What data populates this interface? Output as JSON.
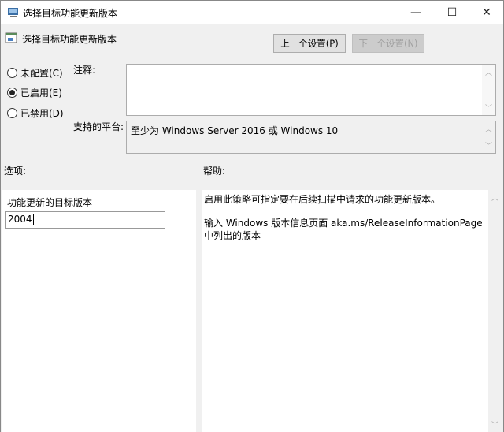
{
  "window": {
    "title": "选择目标功能更新版本",
    "minimize": "—",
    "maximize": "☐",
    "close": "✕"
  },
  "header": {
    "policy_name": "选择目标功能更新版本",
    "prev_button": "上一个设置(P)",
    "next_button": "下一个设置(N)"
  },
  "state": {
    "options": [
      {
        "label": "未配置(C)",
        "checked": false
      },
      {
        "label": "已启用(E)",
        "checked": true
      },
      {
        "label": "已禁用(D)",
        "checked": false
      }
    ]
  },
  "comment": {
    "label": "注释:",
    "value": ""
  },
  "platform": {
    "label": "支持的平台:",
    "value": "至少为 Windows Server 2016 或 Windows 10"
  },
  "options_section": {
    "label": "选项:",
    "field_label": "功能更新的目标版本",
    "field_value": "2004"
  },
  "help_section": {
    "label": "帮助:",
    "paragraphs": [
      "启用此策略可指定要在后续扫描中请求的功能更新版本。",
      "输入 Windows 版本信息页面 aka.ms/ReleaseInformationPage 中列出的版本"
    ]
  }
}
